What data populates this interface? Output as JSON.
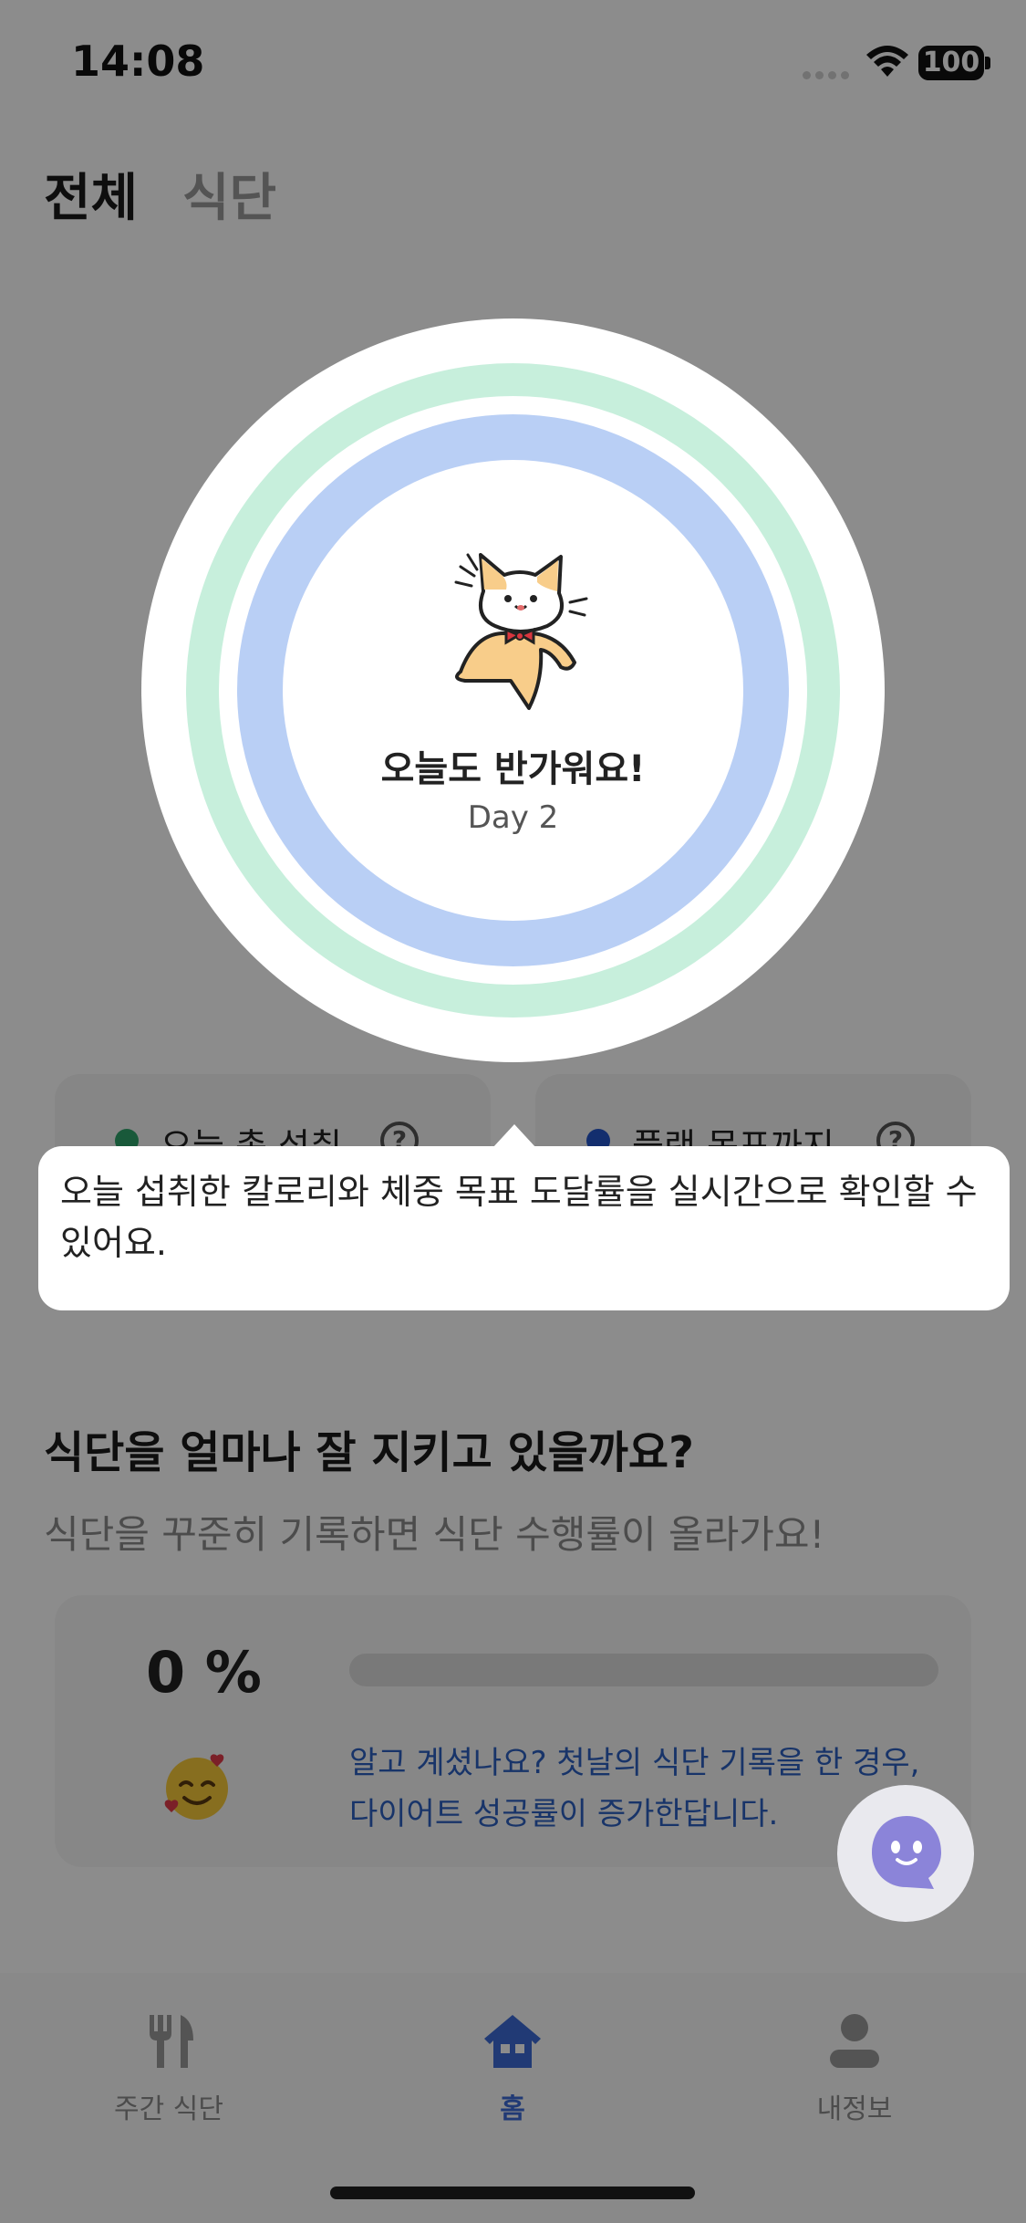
{
  "status_bar": {
    "time": "14:08",
    "battery": "100"
  },
  "header": {
    "tab_all": "전체",
    "tab_diet": "식단"
  },
  "ring": {
    "greeting": "오늘도 반가워요!",
    "day": "Day 2"
  },
  "stat_cards": [
    {
      "label": "오늘 총 섭취",
      "dot_color": "#2fa36b"
    },
    {
      "label": "플랜 목표까지",
      "dot_color": "#2455c9"
    }
  ],
  "tooltip": {
    "text": "오늘 섭취한 칼로리와 체중 목표 도달률을 실시간으로 확인할 수 있어요."
  },
  "diet_section": {
    "title": "식단을 얼마나 잘 지키고 있을까요?",
    "subtitle": "식단을 꾸준히 기록하면 식단 수행률이 올라가요!",
    "percent_label": "0 %",
    "progress_fraction": 0,
    "tip_line1": "알고 계셨나요? 첫날의 식단 기록을 한 경우,",
    "tip_line2": "다이어트 성공률이 증가한답니다."
  },
  "bottom_nav": {
    "items": [
      {
        "label": "주간 식단",
        "icon": "fork-knife-icon",
        "active": false
      },
      {
        "label": "홈",
        "icon": "home-icon",
        "active": true
      },
      {
        "label": "내정보",
        "icon": "person-icon",
        "active": false
      }
    ]
  },
  "colors": {
    "accent": "#3c6ad6",
    "ring_green": "#c7efdc",
    "ring_blue": "#b9cff5",
    "overlay": "rgba(0,0,0,0.45)"
  }
}
